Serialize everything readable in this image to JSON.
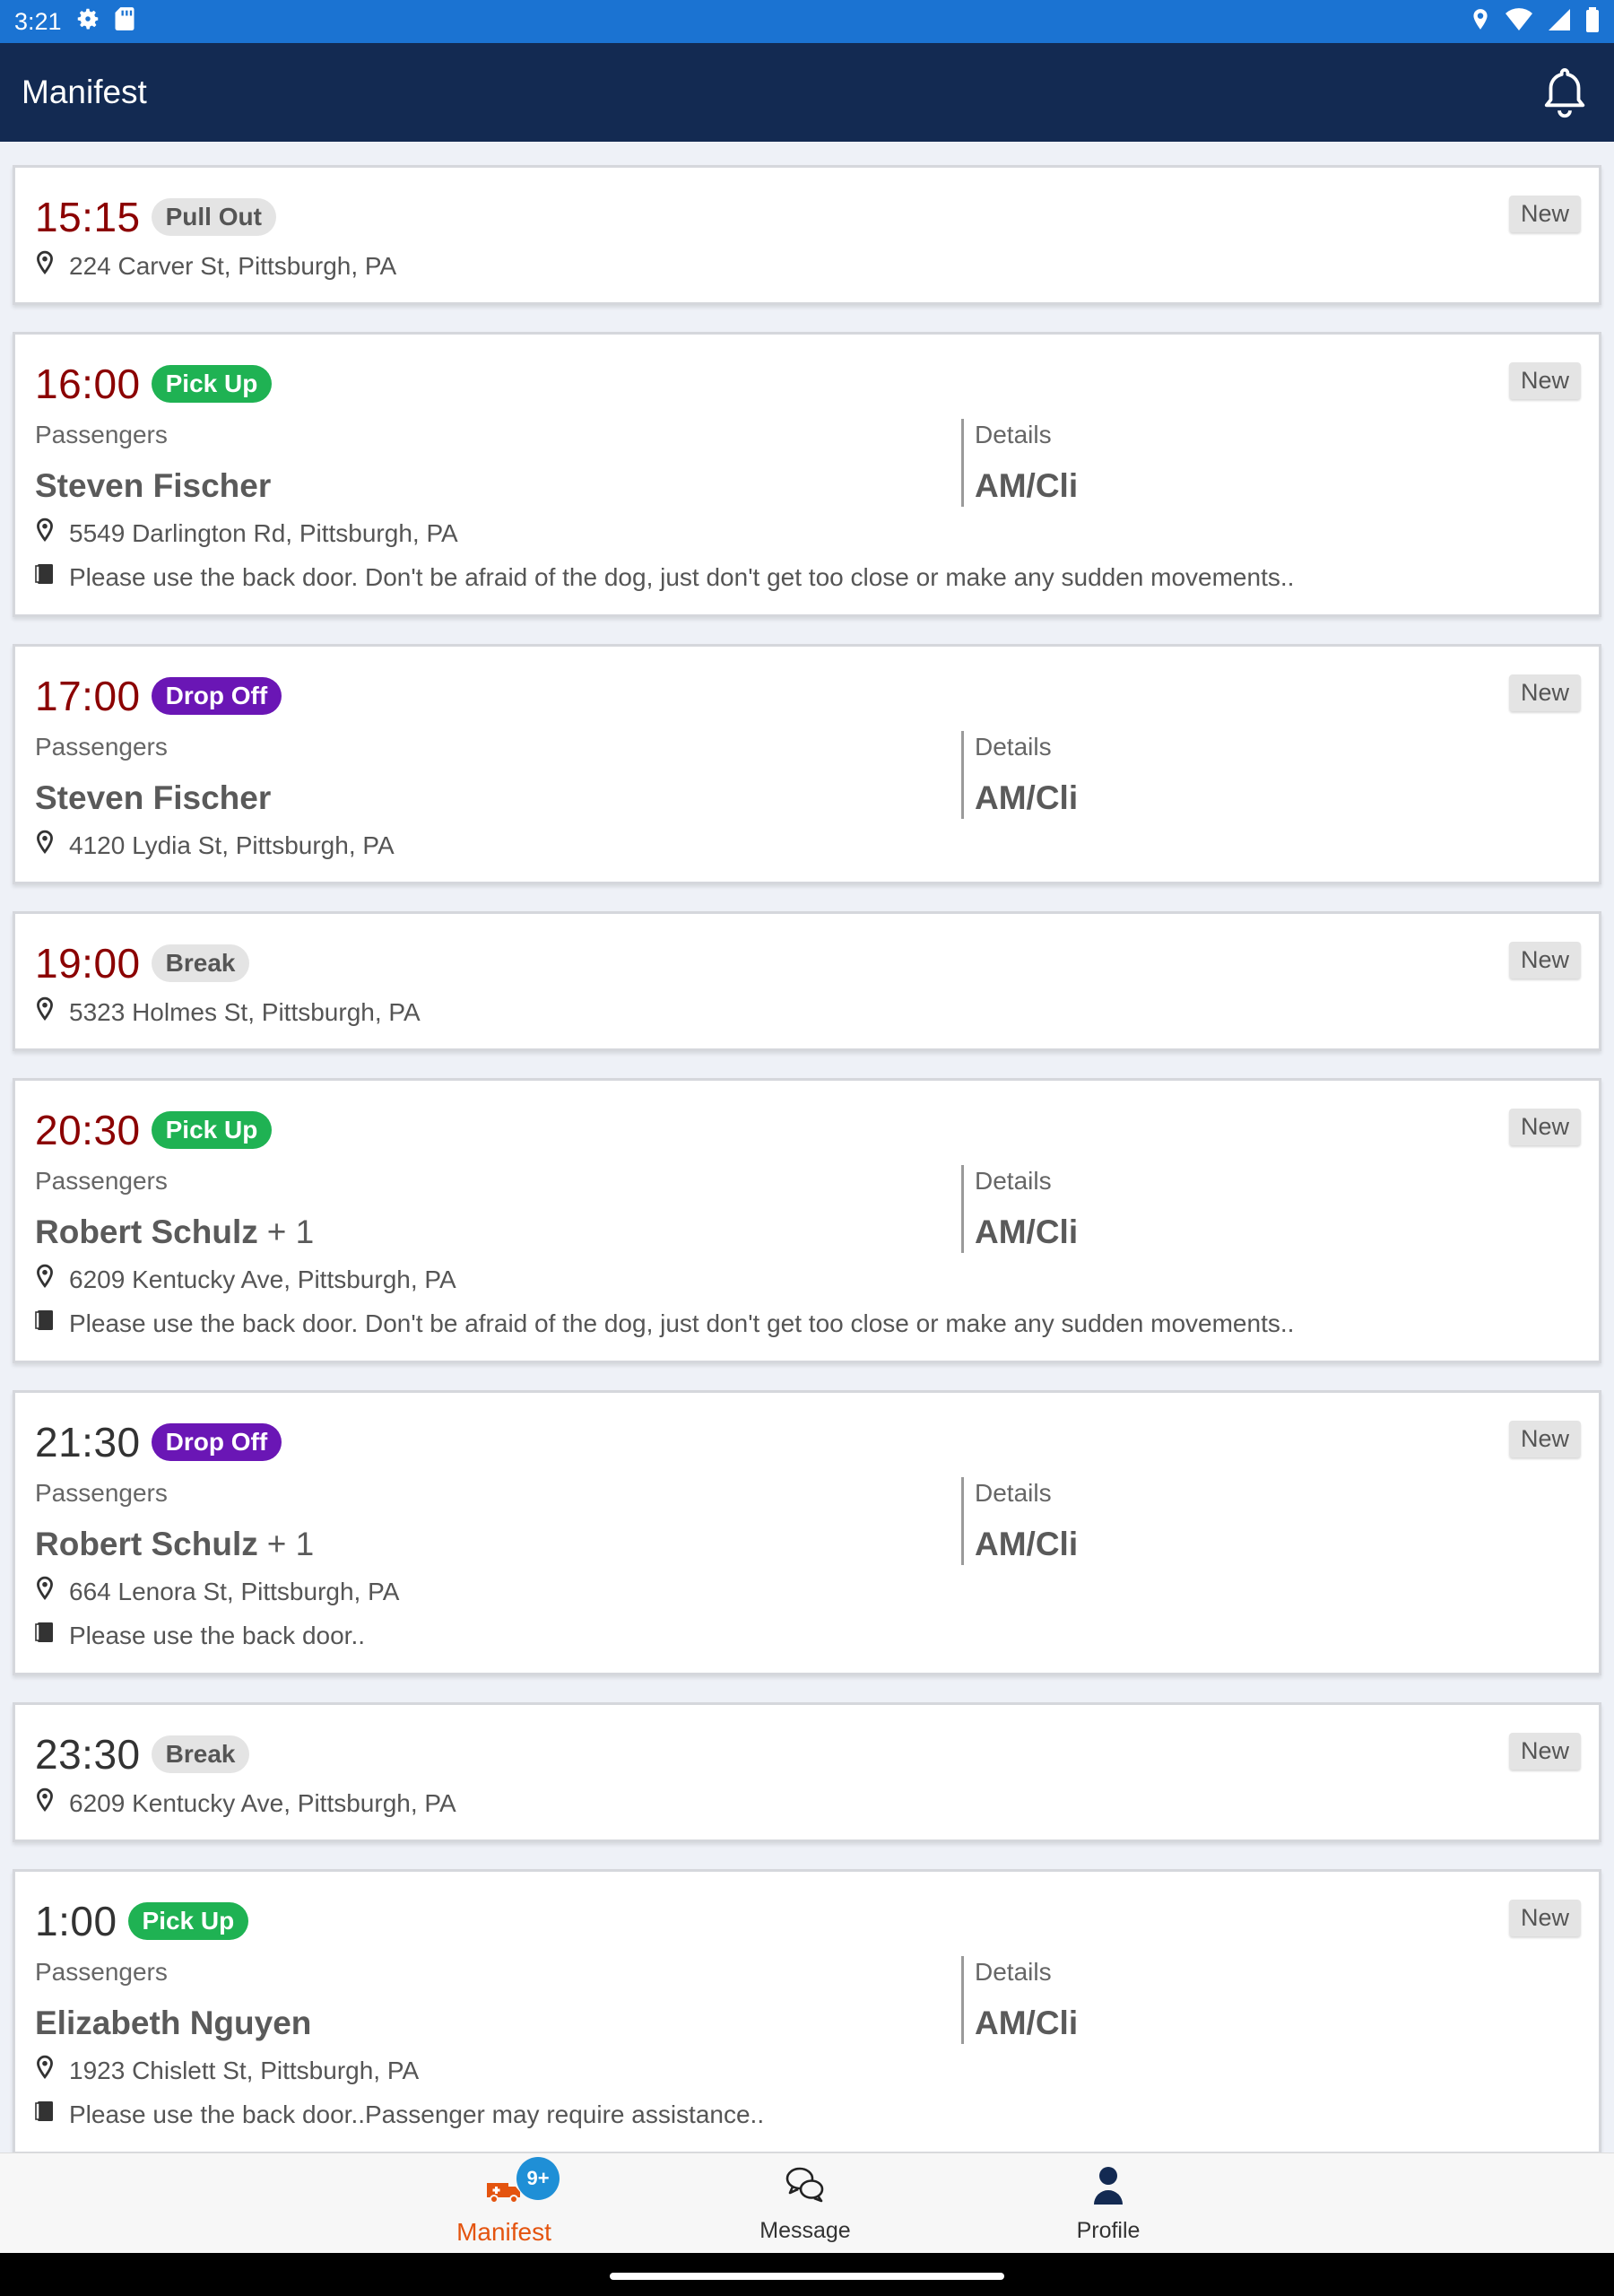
{
  "status_bar": {
    "time": "3:21"
  },
  "app_bar": {
    "title": "Manifest"
  },
  "colors": {
    "status_bar": "#1b73d2",
    "app_bar": "#132a52",
    "time_accent": "#8b0000",
    "time_default": "#333333",
    "pickup": "#1fb253",
    "dropoff": "#6a16b5",
    "neutral_badge": "#e4e4e4",
    "active_nav": "#e4540f"
  },
  "labels": {
    "passengers": "Passengers",
    "details": "Details"
  },
  "trips": [
    {
      "time": "15:15",
      "type": "Pull Out",
      "kind": "neutral",
      "status": "New",
      "time_color": "#8b0000",
      "address": "224 Carver St, Pittsburgh, PA"
    },
    {
      "time": "16:00",
      "type": "Pick Up",
      "kind": "pickup",
      "status": "New",
      "time_color": "#8b0000",
      "passenger": "Steven Fischer",
      "extra": "",
      "details": "AM/Cli",
      "address": "5549 Darlington Rd, Pittsburgh, PA",
      "note": "Please use the back door. Don't be afraid of the dog, just don't get too close or make any sudden movements.."
    },
    {
      "time": "17:00",
      "type": "Drop Off",
      "kind": "dropoff",
      "status": "New",
      "time_color": "#8b0000",
      "passenger": "Steven Fischer",
      "extra": "",
      "details": "AM/Cli",
      "address": "4120 Lydia St, Pittsburgh, PA"
    },
    {
      "time": "19:00",
      "type": "Break",
      "kind": "neutral",
      "status": "New",
      "time_color": "#8b0000",
      "address": "5323 Holmes St, Pittsburgh, PA"
    },
    {
      "time": "20:30",
      "type": "Pick Up",
      "kind": "pickup",
      "status": "New",
      "time_color": "#8b0000",
      "passenger": "Robert Schulz",
      "extra": "+ 1",
      "details": "AM/Cli",
      "address": "6209 Kentucky Ave, Pittsburgh, PA",
      "note": "Please use the back door. Don't be afraid of the dog, just don't get too close or make any sudden movements.."
    },
    {
      "time": "21:30",
      "type": "Drop Off",
      "kind": "dropoff",
      "status": "New",
      "time_color": "#333333",
      "passenger": "Robert Schulz",
      "extra": "+ 1",
      "details": "AM/Cli",
      "address": "664 Lenora St, Pittsburgh, PA",
      "note": "Please use the back door.."
    },
    {
      "time": "23:30",
      "type": "Break",
      "kind": "neutral",
      "status": "New",
      "time_color": "#333333",
      "address": "6209 Kentucky Ave, Pittsburgh, PA"
    },
    {
      "time": "1:00",
      "type": "Pick Up",
      "kind": "pickup",
      "status": "New",
      "time_color": "#333333",
      "passenger": "Elizabeth Nguyen",
      "extra": "",
      "details": "AM/Cli",
      "address": "1923 Chislett St, Pittsburgh, PA",
      "note": "Please use the back door..Passenger may require assistance.."
    }
  ],
  "bottom_nav": {
    "items": [
      {
        "label": "Manifest",
        "icon": "truck-icon",
        "active": true,
        "badge": "9+"
      },
      {
        "label": "Message",
        "icon": "chat-bubbles-icon",
        "active": false
      },
      {
        "label": "Profile",
        "icon": "person-icon",
        "active": false
      }
    ]
  }
}
